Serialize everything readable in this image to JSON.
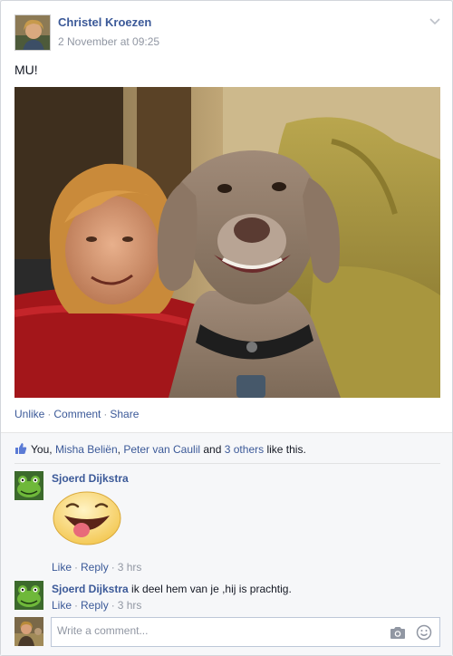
{
  "post": {
    "author": "Christel Kroezen",
    "timestamp": "2 November at 09:25",
    "text": "MU!",
    "actions": {
      "unlike": "Unlike",
      "comment": "Comment",
      "share": "Share"
    }
  },
  "likes": {
    "you": "You,",
    "name1": "Misha Beliën",
    "name2": "Peter van Caulil",
    "and": "and",
    "others": "3 others",
    "suffix": "like this."
  },
  "comments": [
    {
      "author": "Sjoerd Dijkstra",
      "text": "",
      "like": "Like",
      "reply": "Reply",
      "time": "3 hrs"
    },
    {
      "author": "Sjoerd Dijkstra",
      "text": "ik deel hem van je ,hij is prachtig.",
      "like": "Like",
      "reply": "Reply",
      "time": "3 hrs"
    }
  ],
  "composer": {
    "placeholder": "Write a comment..."
  },
  "icons": [
    "chevron-down-icon",
    "thumbs-up-icon",
    "camera-icon",
    "smiley-icon"
  ],
  "colors": {
    "link": "#3b5998",
    "meta": "#9197a3",
    "ufi_bg": "#f6f7f9"
  }
}
